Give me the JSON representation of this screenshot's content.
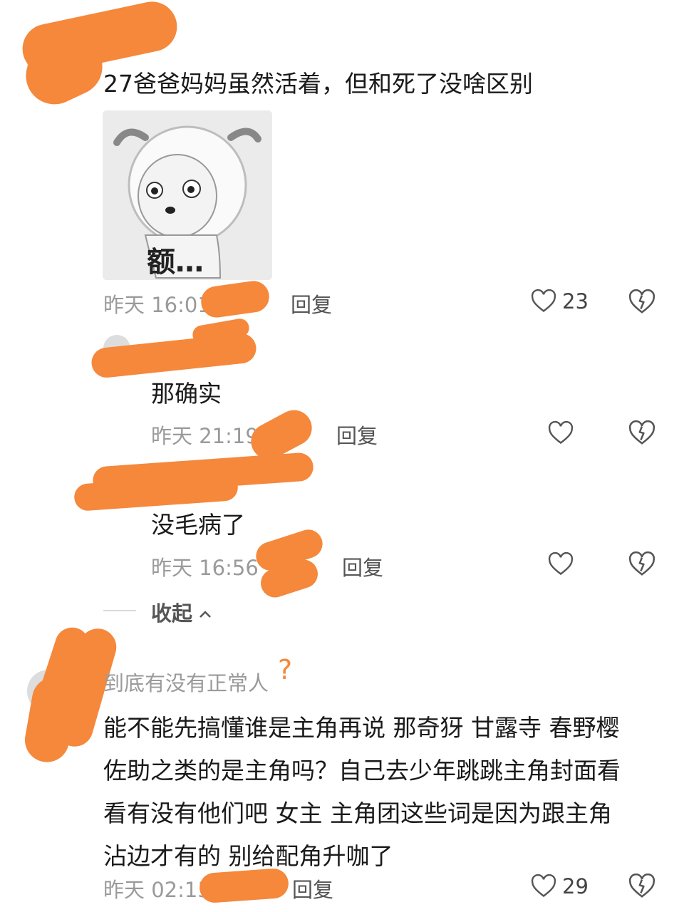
{
  "comments": [
    {
      "text": "27爸爸妈妈虽然活着，但和死了没啥区别",
      "meme_caption": "额…",
      "time": "昨天 16:01",
      "reply_label": "回复",
      "likes": "23"
    },
    {
      "text": "那确实",
      "time": "昨天 21:19",
      "reply_label": "回复"
    },
    {
      "text": "没毛病了",
      "time": "昨天 16:56",
      "reply_label": "回复"
    },
    {
      "username": "到底有没有正常人",
      "text_lines": [
        "能不能先搞懂谁是主角再说 那奇犽 甘露寺 春野樱",
        "佐助之类的是主角吗？自己去少年跳跳主角封面看",
        "看有没有他们吧 女主 主角团这些词是因为跟主角",
        "沾边才有的 别给配角升咖了"
      ],
      "time": "昨天 02:15",
      "reply_label": "回复",
      "likes": "29"
    }
  ],
  "collapse_label": "收起",
  "icons": {
    "like": "heart-outline-icon",
    "dislike": "broken-heart-icon",
    "collapse": "chevron-up-icon"
  },
  "colors": {
    "redaction": "#f5883b"
  }
}
